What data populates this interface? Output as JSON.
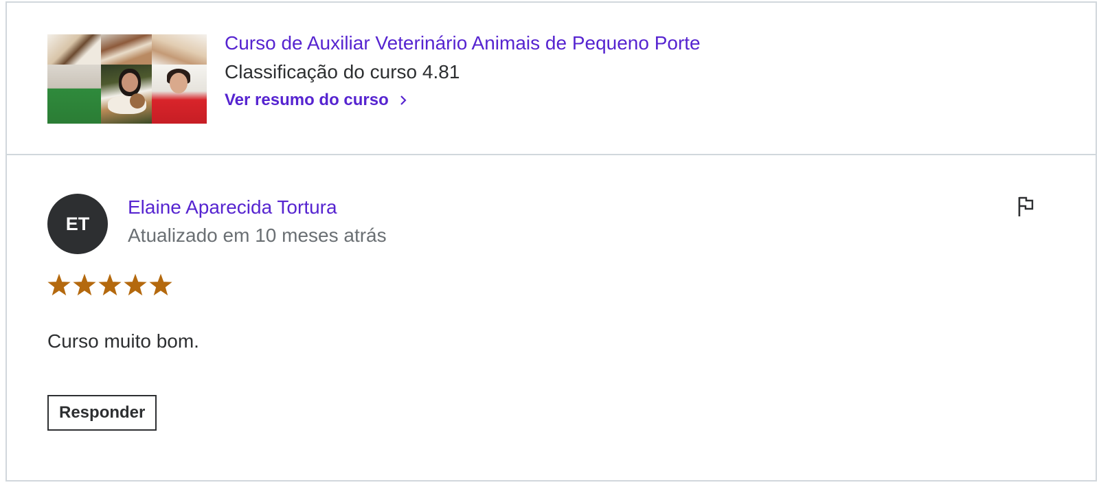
{
  "course": {
    "title": "Curso de Auxiliar Veterinário Animais de Pequeno Porte",
    "rating_text": "Classificação do curso 4.81",
    "link_label": "Ver resumo do curso",
    "link_icon": "chevron-right-icon",
    "thumbnail_icon": "course-thumbnail"
  },
  "review": {
    "avatar_initials": "ET",
    "reviewer_name": "Elaine Aparecida Tortura",
    "updated_text": "Atualizado em 10 meses atrás",
    "flag_icon": "flag-icon",
    "rating": 5,
    "rating_max": 5,
    "body": "Curso muito bom.",
    "reply_label": "Responder"
  },
  "colors": {
    "accent": "#5624d0",
    "text": "#2d2f31",
    "muted": "#6a6f73",
    "star": "#b4690e",
    "border": "#d1d7dc"
  }
}
